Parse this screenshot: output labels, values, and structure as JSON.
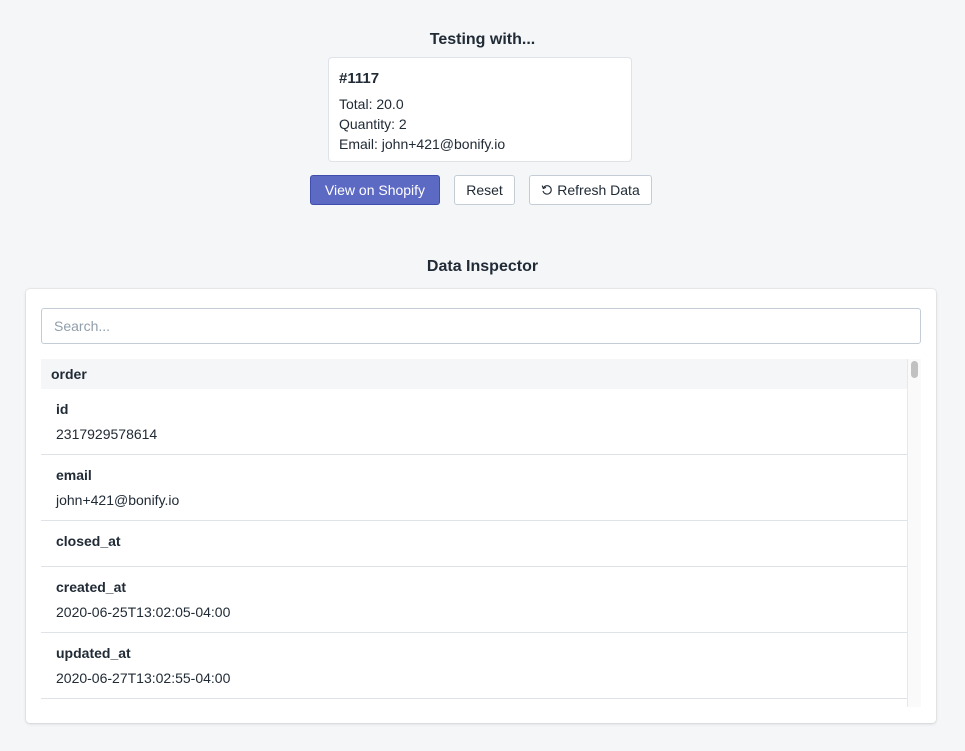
{
  "testing": {
    "title": "Testing with...",
    "order_number": "#1117",
    "total": "Total: 20.0",
    "quantity": "Quantity: 2",
    "email": "Email: john+421@bonify.io"
  },
  "buttons": {
    "view_shopify": "View on Shopify",
    "reset": "Reset",
    "refresh": "Refresh Data",
    "refresh_icon": "refresh-icon"
  },
  "inspector": {
    "title": "Data Inspector",
    "search_placeholder": "Search...",
    "group": "order",
    "rows": [
      {
        "key": "id",
        "value": "2317929578614"
      },
      {
        "key": "email",
        "value": "john+421@bonify.io"
      },
      {
        "key": "closed_at",
        "value": ""
      },
      {
        "key": "created_at",
        "value": "2020-06-25T13:02:05-04:00"
      },
      {
        "key": "updated_at",
        "value": "2020-06-27T13:02:55-04:00"
      }
    ]
  },
  "colors": {
    "primary": "#5c6ac4",
    "background": "#f4f6f8"
  }
}
